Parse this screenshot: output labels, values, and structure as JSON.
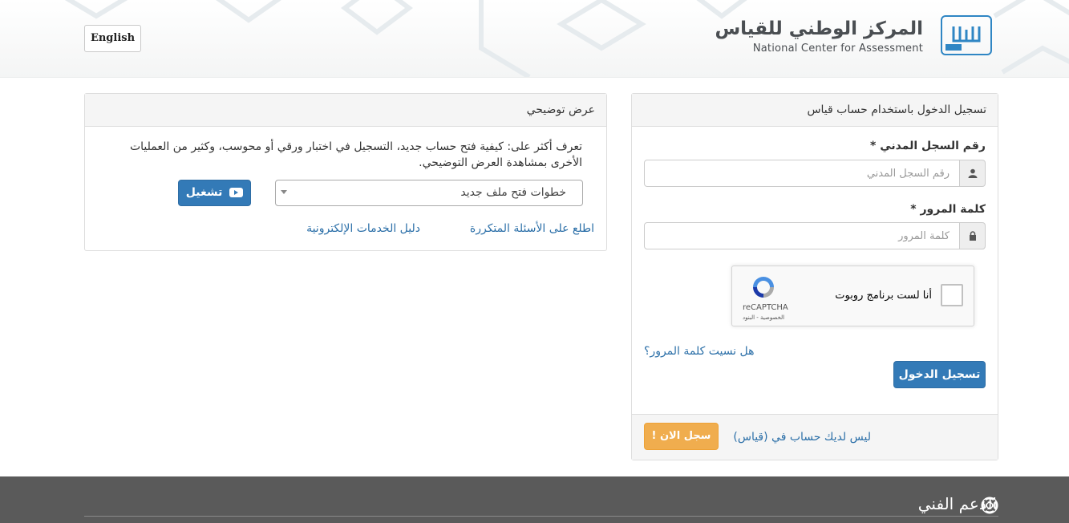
{
  "header": {
    "language_button": "English",
    "logo_title_ar": "المركز الوطني للقياس",
    "logo_title_en": "National Center for Assessment",
    "logo_mark_text": "QIYAS"
  },
  "login": {
    "heading": "تسجيل الدخول باستخدام حساب قياس",
    "civil_id_label": "رقم السجل المدني *",
    "civil_id_placeholder": "رقم السجل المدني",
    "password_label": "كلمة المرور *",
    "password_placeholder": "كلمة المرور",
    "captcha_text": "أنا لست برنامج روبوت",
    "captcha_brand": "reCAPTCHA",
    "captcha_links": "الخصوصية - البنود",
    "forgot_password": "هل نسيت كلمة المرور؟",
    "submit": "تسجيل الدخول",
    "no_account": "ليس لديك حساب في (قياس)",
    "register": "سجل الان !"
  },
  "demo": {
    "heading": "عرض توضيحي",
    "description": "تعرف أكثر على: كيفية فتح حساب جديد، التسجيل في اختبار ورقي أو محوسب، وكثير من العمليات الأخرى بمشاهدة العرض التوضيحي.",
    "select_value": "خطوات فتح ملف جديد",
    "play": "تشغيل",
    "faq_link": "اطلع على الأسئلة المتكررة",
    "guide_link": "دليل الخدمات الإلكترونية"
  },
  "footer": {
    "support_title": "الدعم الفني"
  },
  "colors": {
    "primary": "#337ab7",
    "warning": "#f0ad4e",
    "link": "#2b6fa8",
    "footer_bg": "#5a5a5a",
    "logo_blue": "#2f86c4"
  }
}
